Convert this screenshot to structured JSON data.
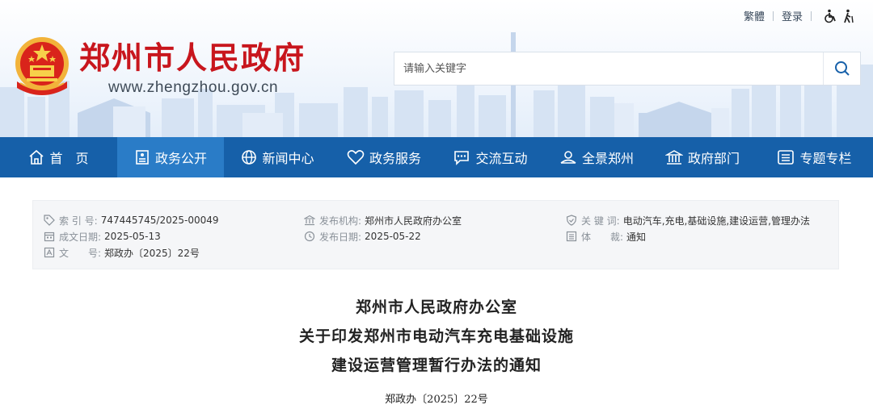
{
  "top_links": {
    "traditional": "繁體",
    "login": "登录"
  },
  "site": {
    "title": "郑州市人民政府",
    "url": "www.zhengzhou.gov.cn"
  },
  "search": {
    "placeholder": "请输入关键字"
  },
  "nav": [
    {
      "label": "首　页",
      "icon": "home-icon"
    },
    {
      "label": "政务公开",
      "icon": "document-icon",
      "active": true
    },
    {
      "label": "新闻中心",
      "icon": "globe-icon"
    },
    {
      "label": "政务服务",
      "icon": "heart-icon"
    },
    {
      "label": "交流互动",
      "icon": "chat-icon"
    },
    {
      "label": "全景郑州",
      "icon": "landscape-icon"
    },
    {
      "label": "政府部门",
      "icon": "building-icon"
    },
    {
      "label": "专题专栏",
      "icon": "columns-icon"
    }
  ],
  "meta": {
    "index_label": "索 引 号:",
    "index_value": "747445745/2025-00049",
    "created_label": "成文日期:",
    "created_value": "2025-05-13",
    "docno_label": "文　　号:",
    "docno_value": "郑政办〔2025〕22号",
    "issuer_label": "发布机构:",
    "issuer_value": "郑州市人民政府办公室",
    "published_label": "发布日期:",
    "published_value": "2025-05-22",
    "keywords_label": "关 键 词:",
    "keywords_value": "电动汽车,充电,基础设施,建设运营,管理办法",
    "genre_label": "体　　裁:",
    "genre_value": "通知"
  },
  "article": {
    "title_lines": [
      "郑州市人民政府办公室",
      "关于印发郑州市电动汽车充电基础设施",
      "建设运营管理暂行办法的通知"
    ],
    "doc_number": "郑政办〔2025〕22号"
  },
  "colors": {
    "brand_red": "#c8161d",
    "nav_blue": "#1660a9",
    "nav_active": "#2a7cc7"
  }
}
